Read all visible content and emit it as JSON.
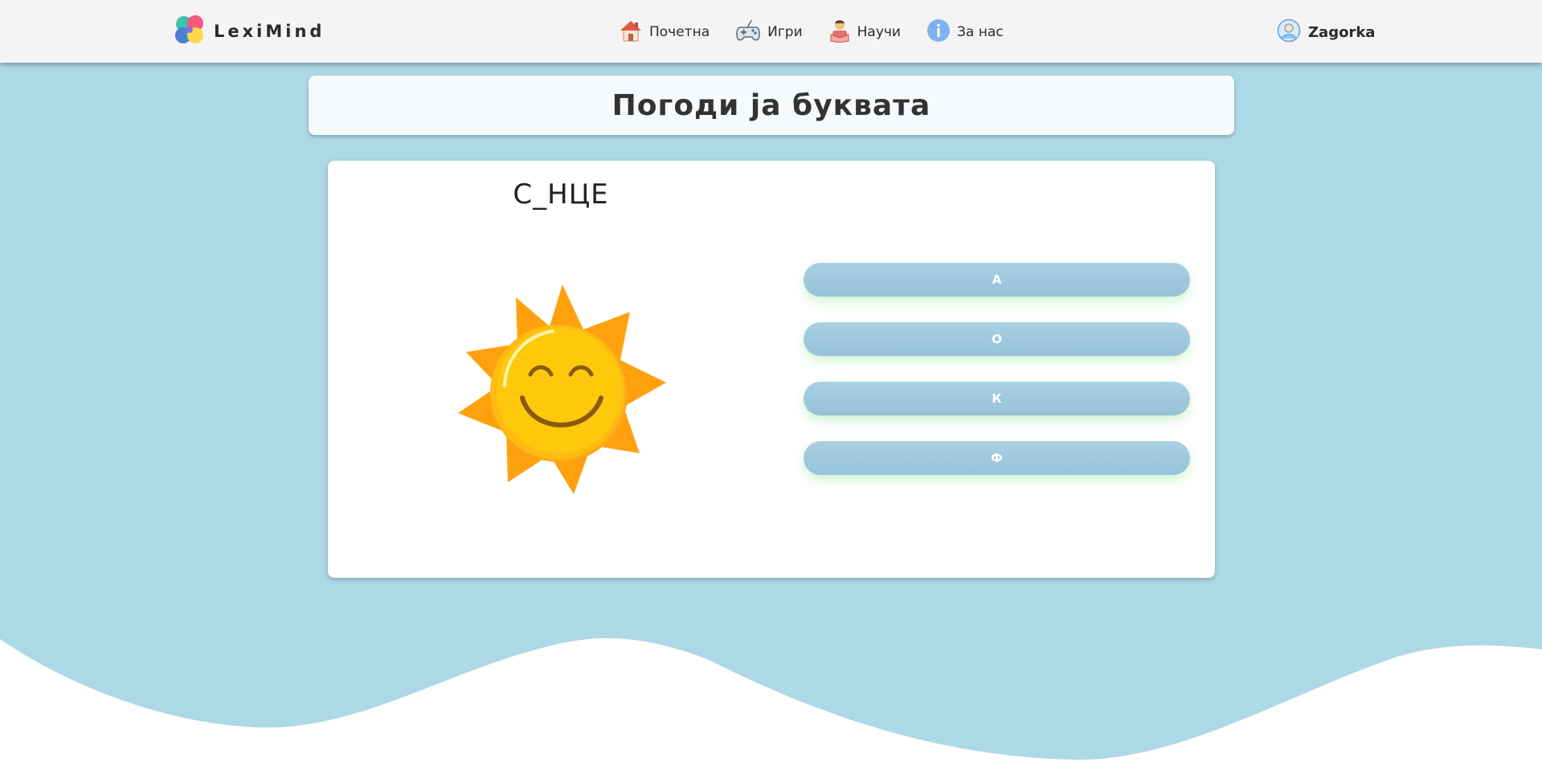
{
  "colors": {
    "wave_blue": "#add8e6",
    "navbar_bg": "#f4f4f4",
    "answer_button": "#a2c8dd",
    "sun_orange": "#ffa10f",
    "sun_face": "#ffc80a"
  },
  "navbar": {
    "brand": "LexiMind",
    "brand_icon": "puzzle-brain-icon",
    "links": [
      {
        "label": "Почетна",
        "icon": "house-icon"
      },
      {
        "label": "Игри",
        "icon": "gamepad-icon"
      },
      {
        "label": "Научи",
        "icon": "student-reading-icon"
      },
      {
        "label": "За нас",
        "icon": "info-icon"
      }
    ],
    "user": {
      "name": "Zagorka",
      "icon": "user-avatar-icon"
    }
  },
  "game": {
    "title": "Погоди ја буквата",
    "word": "С_НЦЕ",
    "image": "smiling-sun-icon",
    "options": [
      "А",
      "О",
      "К",
      "Ф"
    ]
  }
}
